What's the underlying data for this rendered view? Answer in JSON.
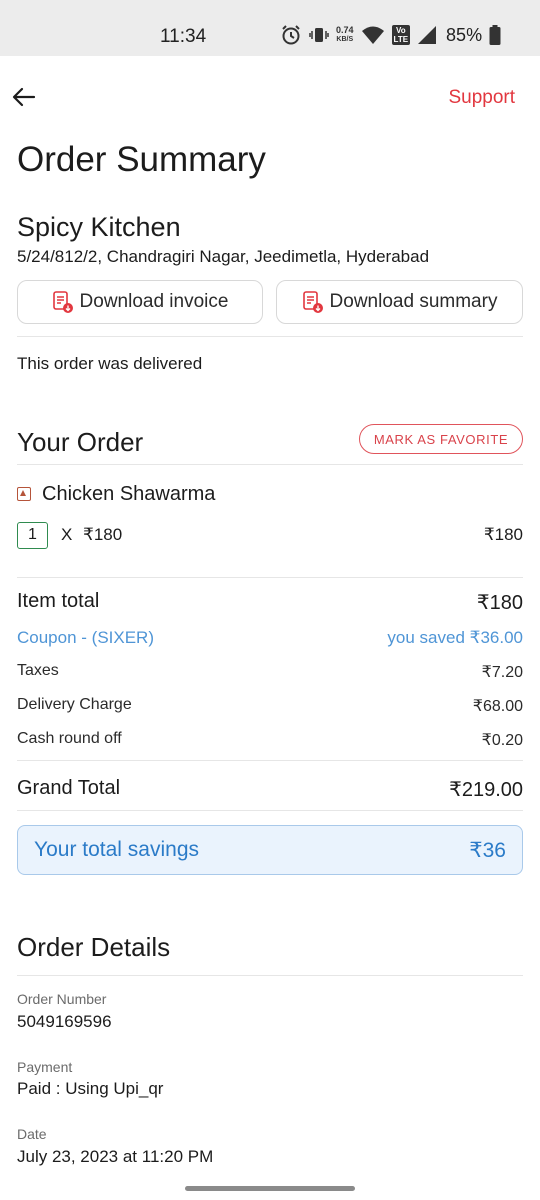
{
  "status_bar": {
    "time": "11:34",
    "net_speed_value": "0.74",
    "net_speed_unit": "KB/S",
    "volte_top": "Vo",
    "volte_bottom": "LTE",
    "battery": "85%"
  },
  "header": {
    "back_icon": "arrow-left-icon",
    "support_label": "Support",
    "accent_color": "#e2373f"
  },
  "page_title": "Order Summary",
  "restaurant": {
    "name": "Spicy Kitchen",
    "address": "5/24/812/2, Chandragiri Nagar, Jeedimetla, Hyderabad"
  },
  "actions": {
    "download_invoice": "Download invoice",
    "download_summary": "Download summary",
    "icon": "document-download-icon"
  },
  "order_status": "This order was delivered",
  "your_order": {
    "title": "Your Order",
    "favorite_label": "MARK AS FAVORITE",
    "items": [
      {
        "name": "Chicken Shawarma",
        "qty": "1",
        "x": "X",
        "unit_price": "₹180",
        "total": "₹180"
      }
    ]
  },
  "bill": {
    "item_total_label": "Item total",
    "item_total_value": "₹180",
    "coupon_label": "Coupon - (SIXER)",
    "coupon_value": "you saved ₹36.00",
    "taxes_label": "Taxes",
    "taxes_value": "₹7.20",
    "delivery_label": "Delivery Charge",
    "delivery_value": "₹68.00",
    "roundoff_label": "Cash round off",
    "roundoff_value": "₹0.20",
    "grand_total_label": "Grand Total",
    "grand_total_value": "₹219.00"
  },
  "savings": {
    "label": "Your total savings",
    "value": "₹36",
    "color": "#2b7bc8"
  },
  "order_details": {
    "title": "Order Details",
    "order_number_label": "Order Number",
    "order_number": "5049169596",
    "payment_label": "Payment",
    "payment_value": "Paid : Using Upi_qr",
    "date_label": "Date",
    "date_value": "July 23, 2023 at 11:20 PM"
  }
}
